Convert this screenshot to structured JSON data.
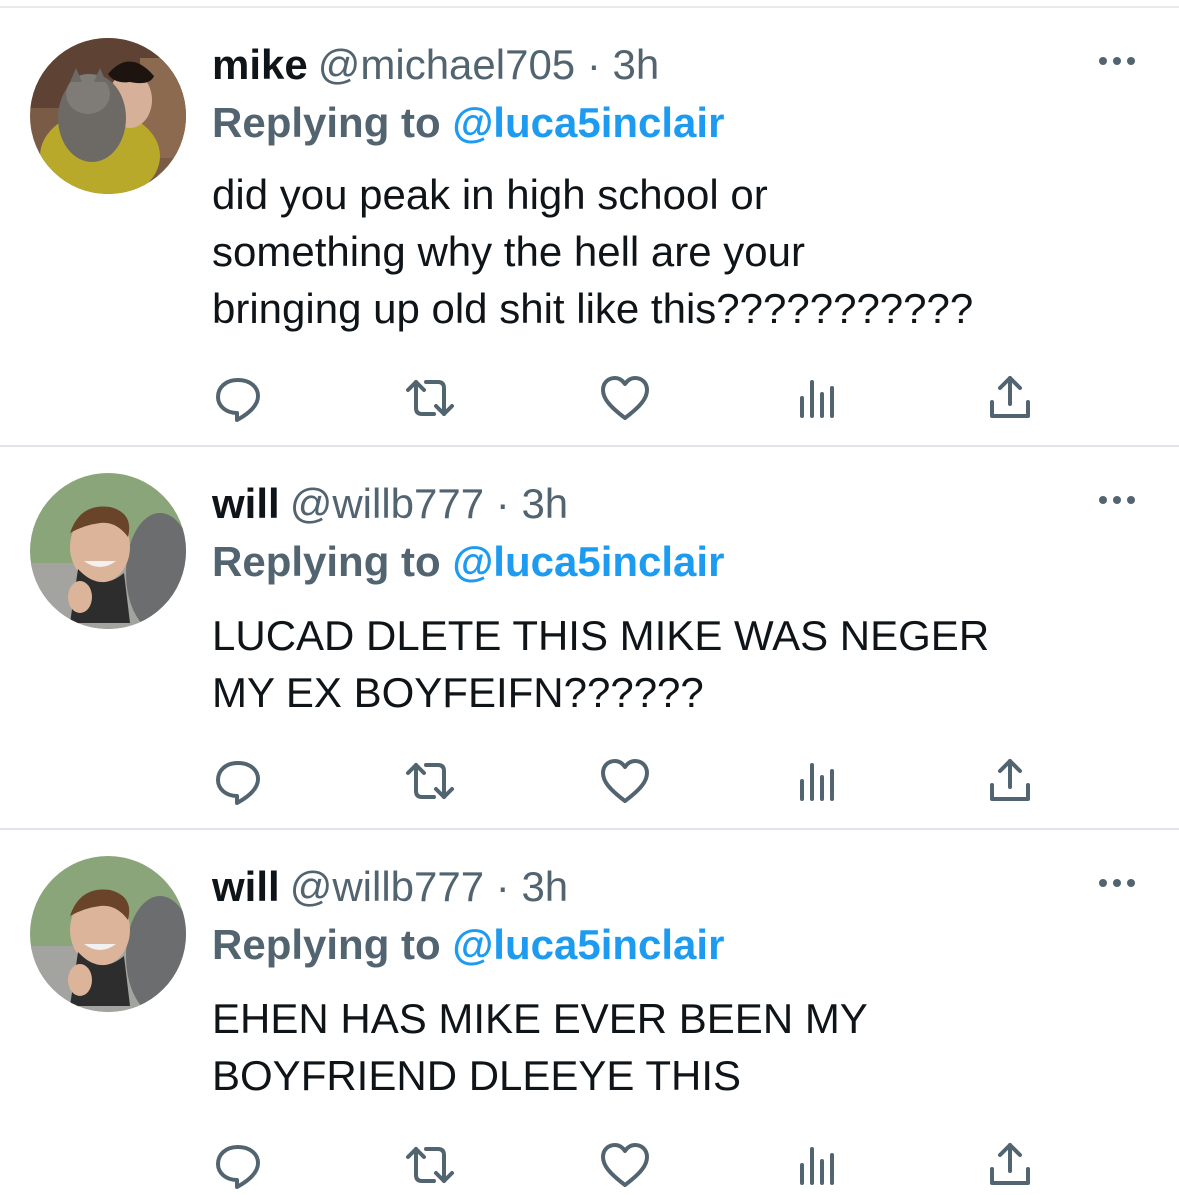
{
  "tweets": [
    {
      "name": "mike",
      "handle": "@michael705",
      "separator": "·",
      "time": "3h",
      "replying_prefix": "Replying to",
      "replying_to": "@luca5inclair",
      "text": "did you peak in high school or\nsomething why the hell are your\nbringing up old shit like this???????????",
      "avatar_icon": "avatar-photo-with-cat"
    },
    {
      "name": "will",
      "handle": "@willb777",
      "separator": "·",
      "time": "3h",
      "replying_prefix": "Replying to",
      "replying_to": "@luca5inclair",
      "text": "LUCAD DLETE THIS MIKE WAS NEGER\nMY EX BOYFEIFN??????",
      "avatar_icon": "avatar-photo-selfie"
    },
    {
      "name": "will",
      "handle": "@willb777",
      "separator": "·",
      "time": "3h",
      "replying_prefix": "Replying to",
      "replying_to": "@luca5inclair",
      "text": "EHEN HAS MIKE EVER BEEN MY\nBOYFRIEND DLEEYE THIS",
      "avatar_icon": "avatar-photo-selfie"
    }
  ],
  "icons": {
    "more": "more-horizontal-icon",
    "reply": "reply-icon",
    "retweet": "retweet-icon",
    "like": "heart-icon",
    "views": "views-bar-chart-icon",
    "share": "share-icon"
  },
  "colors": {
    "text": "#0f1419",
    "secondary": "#536471",
    "accent": "#1d9bf0",
    "icon": "#536471",
    "divider": "#e1e4e8"
  }
}
